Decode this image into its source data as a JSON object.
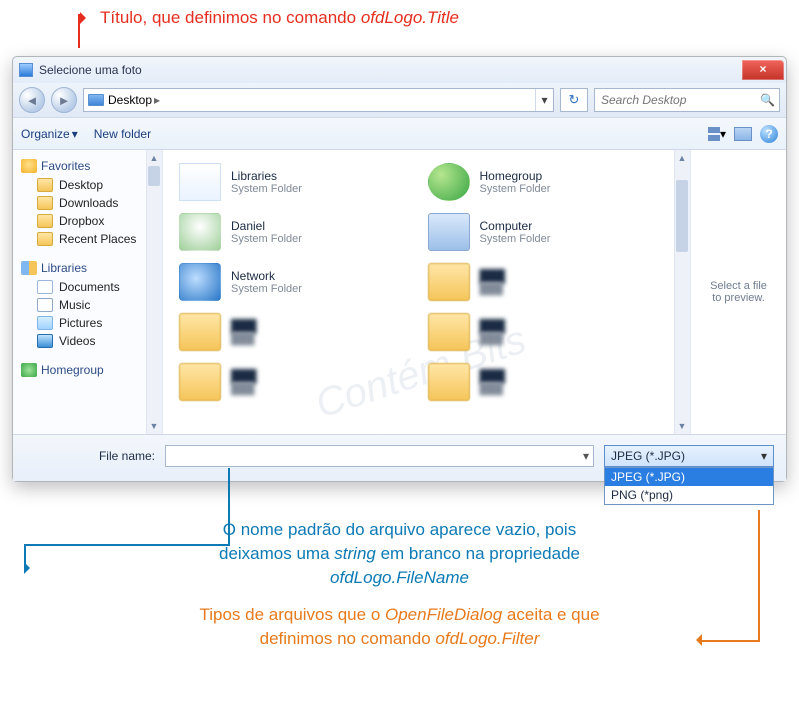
{
  "annotations": {
    "title_pre": "Título, que definimos no comando ",
    "title_em": "ofdLogo.Title",
    "filename_l1a": "O nome padrão do arquivo aparece vazio, pois",
    "filename_l2a": "deixamos uma ",
    "filename_l2b": "string",
    "filename_l2c": " em branco na propriedade",
    "filename_l3": "ofdLogo.FileName",
    "filter_l1a": "Tipos de arquivos que o ",
    "filter_l1b": "OpenFileDialog",
    "filter_l1c": " aceita e que",
    "filter_l2a": "definimos no comando ",
    "filter_l2b": "ofdLogo.Filter"
  },
  "window": {
    "title": "Selecione uma foto",
    "close": "×"
  },
  "nav": {
    "back_glyph": "◄",
    "fwd_glyph": "►",
    "breadcrumb_item": "Desktop",
    "breadcrumb_chevron": "▸",
    "addr_dropdown": "▾",
    "refresh": "↻",
    "search_placeholder": "Search Desktop",
    "search_icon": "🔍"
  },
  "toolbar": {
    "organize": "Organize",
    "organize_caret": "▾",
    "newfolder": "New folder",
    "view_caret": "▾",
    "help": "?"
  },
  "sidebar": {
    "favorites": "Favorites",
    "fav_items": [
      "Desktop",
      "Downloads",
      "Dropbox",
      "Recent Places"
    ],
    "libraries": "Libraries",
    "lib_items": [
      "Documents",
      "Music",
      "Pictures",
      "Videos"
    ],
    "homegroup": "Homegroup"
  },
  "files": {
    "items": [
      {
        "name": "Libraries",
        "sub": "System Folder",
        "icon": "lib"
      },
      {
        "name": "Homegroup",
        "sub": "System Folder",
        "icon": "hg"
      },
      {
        "name": "Daniel",
        "sub": "System Folder",
        "icon": "person"
      },
      {
        "name": "Computer",
        "sub": "System Folder",
        "icon": "comp"
      },
      {
        "name": "Network",
        "sub": "System Folder",
        "icon": "net"
      },
      {
        "name": "",
        "sub": "",
        "icon": "blur",
        "blur": true
      },
      {
        "name": "",
        "sub": "",
        "icon": "blur",
        "blur": true
      },
      {
        "name": "",
        "sub": "",
        "icon": "blur",
        "blur": true
      },
      {
        "name": "",
        "sub": "",
        "icon": "blur",
        "blur": true
      },
      {
        "name": "",
        "sub": "",
        "icon": "blur",
        "blur": true
      }
    ]
  },
  "preview": {
    "line1": "Select a file",
    "line2": "to preview."
  },
  "watermark": "Contém Bits",
  "footer": {
    "label": "File name:",
    "filename_value": "",
    "filter_selected": "JPEG (*.JPG)",
    "filter_caret": "▾",
    "filter_options": [
      "JPEG (*.JPG)",
      "PNG (*png)"
    ]
  }
}
